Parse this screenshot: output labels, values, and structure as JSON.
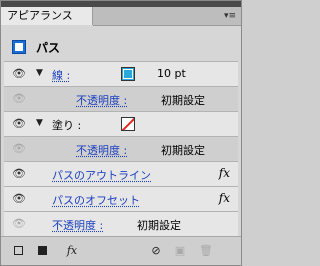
{
  "panel": {
    "tab_title": "アピアランス",
    "menu_icon": "panel-menu-icon"
  },
  "header": {
    "title": "パス"
  },
  "rows": {
    "stroke": {
      "label": "線 :",
      "value": "10 pt"
    },
    "stroke_opacity": {
      "label": "不透明度 :",
      "value": "初期設定"
    },
    "fill": {
      "label": "塗り :"
    },
    "fill_opacity": {
      "label": "不透明度 :",
      "value": "初期設定"
    },
    "effect1": {
      "label": "パスのアウトライン",
      "fx": "fx"
    },
    "effect2": {
      "label": "パスのオフセット",
      "fx": "fx"
    },
    "opacity": {
      "label": "不透明度 :",
      "value": "初期設定"
    }
  },
  "footer": {
    "fx_label": "fx"
  }
}
